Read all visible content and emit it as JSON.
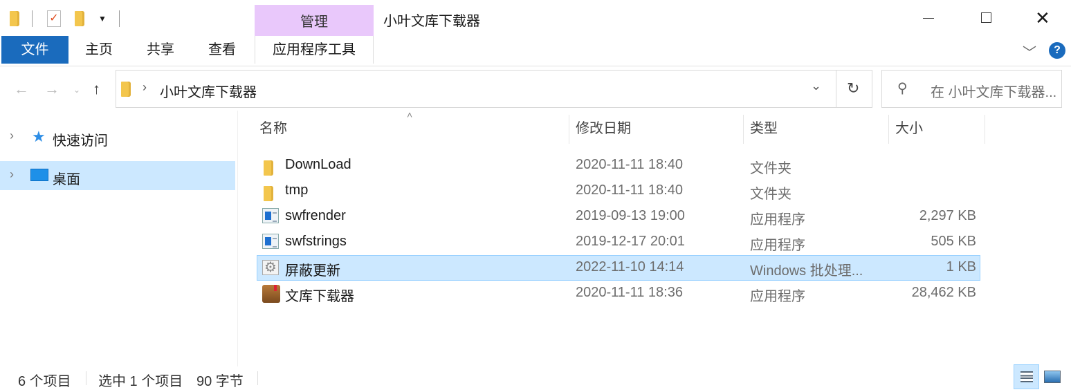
{
  "window": {
    "title": "小叶文库下载器",
    "context_tab": "管理",
    "context_color": "#e9c8fb"
  },
  "ribbon": {
    "tabs": [
      "文件",
      "主页",
      "共享",
      "查看",
      "应用程序工具"
    ],
    "file_tab_color": "#1a6bbd"
  },
  "address": {
    "path": "小叶文库下载器",
    "search_placeholder": "在 小叶文库下载器..."
  },
  "nav": {
    "items": [
      {
        "label": "快速访问",
        "icon": "star-icon"
      },
      {
        "label": "桌面",
        "icon": "desktop-icon",
        "selected": true
      }
    ]
  },
  "columns": {
    "name": "名称",
    "date": "修改日期",
    "type": "类型",
    "size": "大小"
  },
  "files": [
    {
      "name": "DownLoad",
      "date": "2020-11-11 18:40",
      "type": "文件夹",
      "size": "",
      "icon": "folder-icon"
    },
    {
      "name": "tmp",
      "date": "2020-11-11 18:40",
      "type": "文件夹",
      "size": "",
      "icon": "folder-icon"
    },
    {
      "name": "swfrender",
      "date": "2019-09-13 19:00",
      "type": "应用程序",
      "size": "2,297 KB",
      "icon": "app-icon"
    },
    {
      "name": "swfstrings",
      "date": "2019-12-17 20:01",
      "type": "应用程序",
      "size": "505 KB",
      "icon": "app-icon"
    },
    {
      "name": "屏蔽更新",
      "date": "2022-11-10 14:14",
      "type": "Windows 批处理...",
      "size": "1 KB",
      "icon": "batch-file-icon",
      "selected": true
    },
    {
      "name": "文库下载器",
      "date": "2020-11-11 18:36",
      "type": "应用程序",
      "size": "28,462 KB",
      "icon": "book-app-icon"
    }
  ],
  "status": {
    "count": "6 个项目",
    "selection": "选中 1 个项目",
    "bytes": "90 字节"
  }
}
